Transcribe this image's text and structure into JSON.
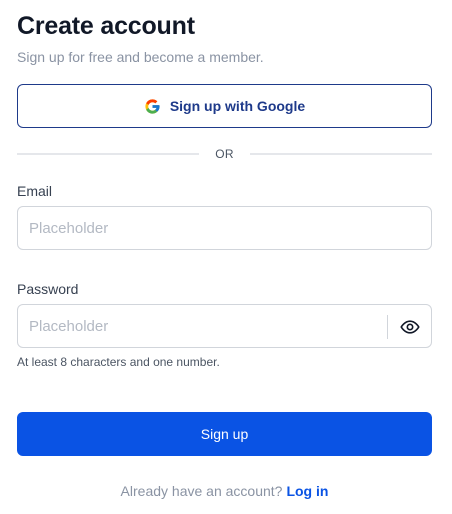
{
  "header": {
    "title": "Create account",
    "subtitle": "Sign up for free and become a member."
  },
  "google": {
    "label": "Sign up with Google",
    "icon": "google-logo-icon"
  },
  "divider": {
    "label": "OR"
  },
  "email": {
    "label": "Email",
    "placeholder": "Placeholder",
    "value": ""
  },
  "password": {
    "label": "Password",
    "placeholder": "Placeholder",
    "value": "",
    "toggle_icon": "eye-icon",
    "hint": "At least 8 characters and one number."
  },
  "submit": {
    "label": "Sign up"
  },
  "footer": {
    "question": "Already have an account?",
    "link": "Log in"
  },
  "colors": {
    "primary": "#0a53e4",
    "google_border": "#1e3a8a",
    "muted_text": "#8a93a3"
  }
}
